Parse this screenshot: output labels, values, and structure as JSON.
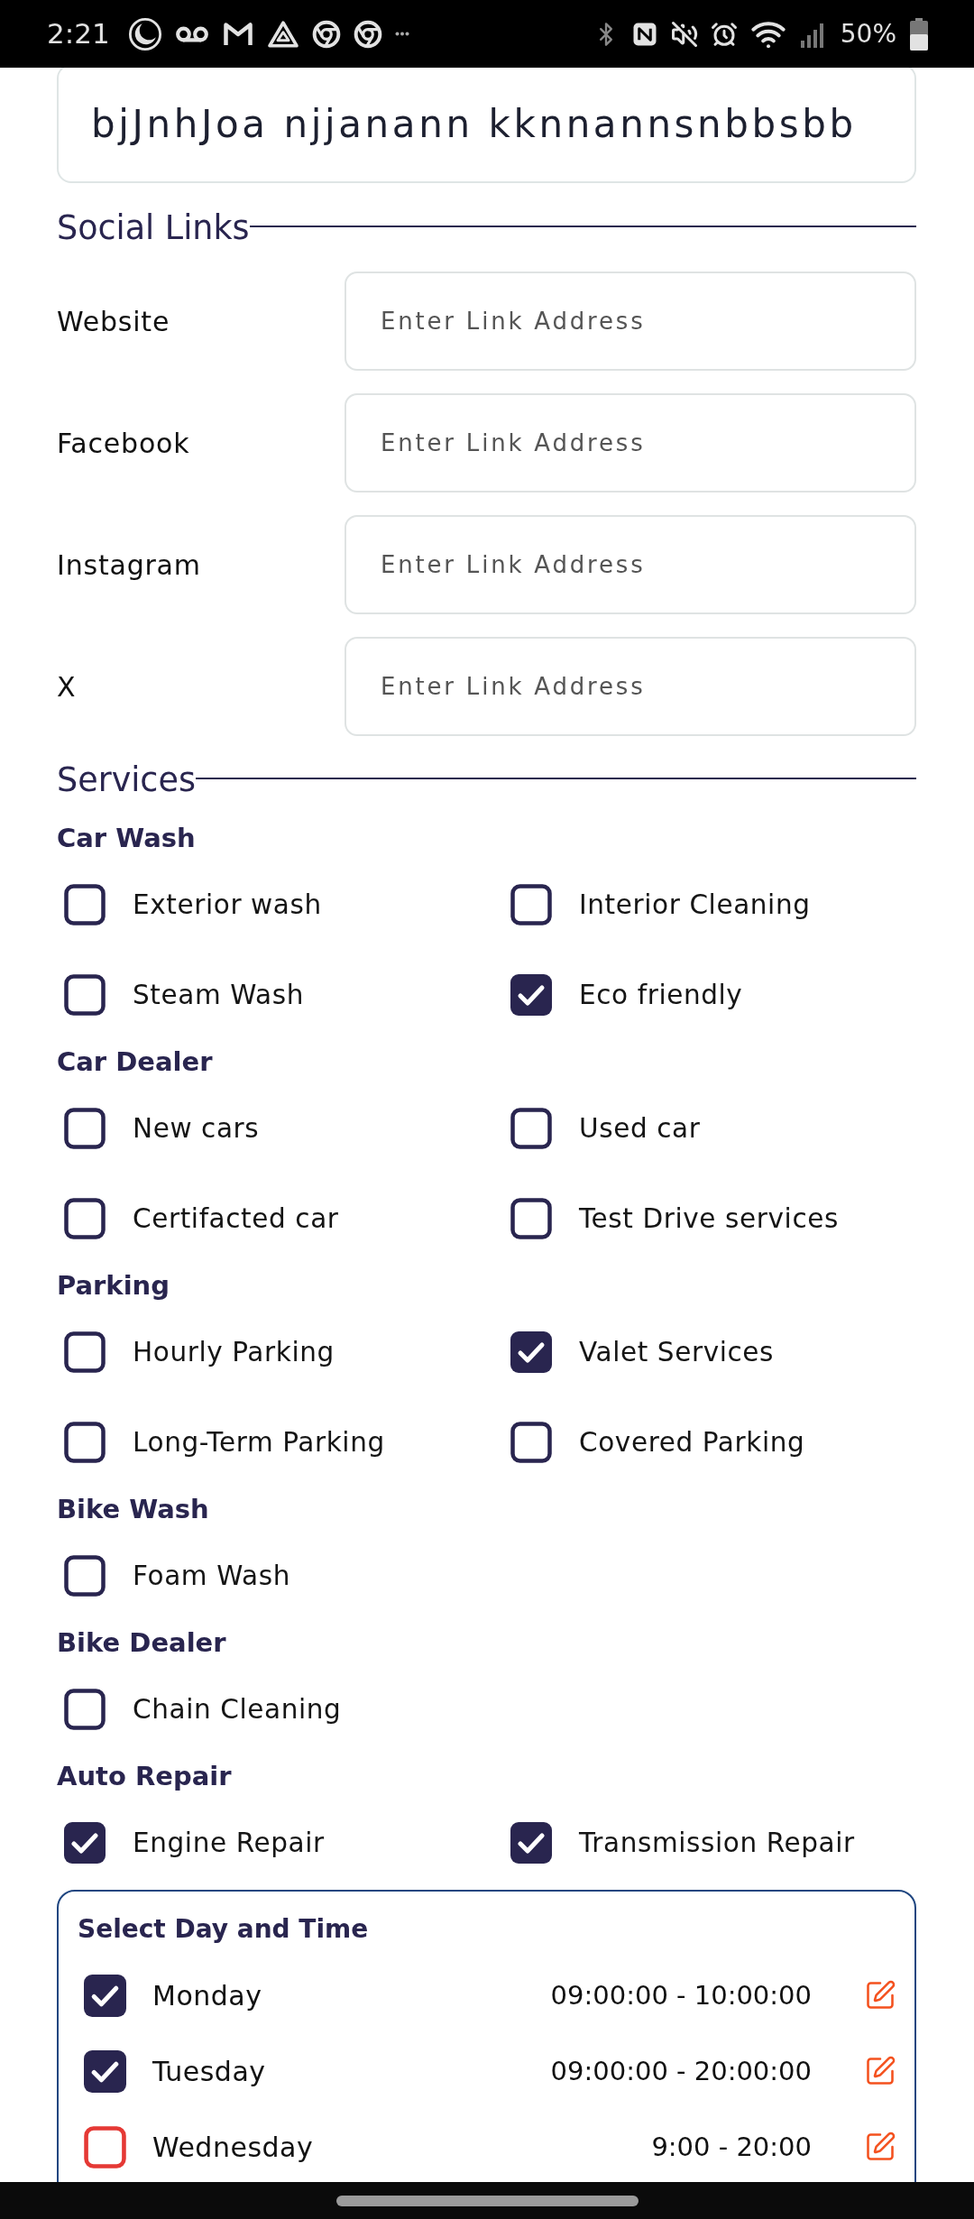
{
  "status_bar": {
    "time": "2:21",
    "battery": "50%"
  },
  "top_field": {
    "value": "bjJnhJoa njjanann kknnannsnbbsbb"
  },
  "social_links": {
    "title": "Social Links",
    "fields": [
      {
        "label": "Website",
        "placeholder": "Enter Link Address"
      },
      {
        "label": "Facebook",
        "placeholder": "Enter Link Address"
      },
      {
        "label": "Instagram",
        "placeholder": "Enter Link Address"
      },
      {
        "label": "X",
        "placeholder": "Enter Link Address"
      }
    ]
  },
  "services": {
    "title": "Services",
    "categories": [
      {
        "name": "Car Wash",
        "options": [
          {
            "label": "Exterior wash",
            "checked": false
          },
          {
            "label": "Interior Cleaning",
            "checked": false
          },
          {
            "label": "Steam Wash",
            "checked": false
          },
          {
            "label": "Eco friendly",
            "checked": true
          }
        ]
      },
      {
        "name": "Car Dealer",
        "options": [
          {
            "label": "New cars",
            "checked": false
          },
          {
            "label": "Used car",
            "checked": false
          },
          {
            "label": "Certifacted car",
            "checked": false
          },
          {
            "label": "Test Drive services",
            "checked": false
          }
        ]
      },
      {
        "name": "Parking",
        "options": [
          {
            "label": "Hourly Parking",
            "checked": false
          },
          {
            "label": "Valet Services",
            "checked": true
          },
          {
            "label": "Long-Term Parking",
            "checked": false
          },
          {
            "label": "Covered Parking",
            "checked": false
          }
        ]
      },
      {
        "name": "Bike Wash",
        "options": [
          {
            "label": "Foam Wash",
            "checked": false
          }
        ]
      },
      {
        "name": "Bike Dealer",
        "options": [
          {
            "label": "Chain Cleaning",
            "checked": false
          }
        ]
      },
      {
        "name": "Auto Repair",
        "options": [
          {
            "label": "Engine Repair",
            "checked": true
          },
          {
            "label": "Transmission Repair",
            "checked": true
          }
        ]
      }
    ]
  },
  "schedule": {
    "title": "Select Day and Time",
    "days": [
      {
        "day": "Monday",
        "checked": true,
        "hours": "09:00:00 - 10:00:00"
      },
      {
        "day": "Tuesday",
        "checked": true,
        "hours": "09:00:00 - 20:00:00"
      },
      {
        "day": "Wednesday",
        "checked": false,
        "hours": "9:00 - 20:00"
      }
    ]
  }
}
